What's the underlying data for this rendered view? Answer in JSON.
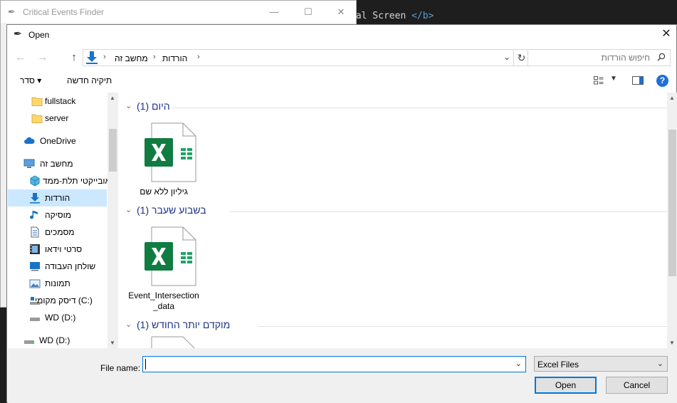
{
  "background": {
    "editor_code_prefix": "ial Screen ",
    "editor_code_tag": "</b>"
  },
  "parent_window": {
    "title": "Critical Events Finder",
    "minimize": "—",
    "maximize": "☐",
    "close": "✕"
  },
  "dialog": {
    "title": "Open",
    "close": "✕",
    "nav": {
      "back": "←",
      "forward": "→",
      "up": "↑"
    },
    "address": {
      "crumbs": [
        "מחשב זה",
        "הורדות"
      ],
      "separator": "›"
    },
    "search": {
      "placeholder": "חיפוש הורדות"
    },
    "toolbar": {
      "organize": "סדר ▾",
      "new_folder": "תיקיה חדשה",
      "view_drop": "▼",
      "help": "?"
    },
    "nav_pane": {
      "items": [
        {
          "label": "fullstack",
          "icon": "folder-icon"
        },
        {
          "label": "server",
          "icon": "folder-icon"
        },
        {
          "label": "OneDrive",
          "icon": "cloud-icon"
        },
        {
          "label": "מחשב זה",
          "icon": "computer-icon"
        },
        {
          "label": "אובייקטי תלת-ממד",
          "icon": "cube-icon"
        },
        {
          "label": "הורדות",
          "icon": "download-icon",
          "selected": true
        },
        {
          "label": "מוסיקה",
          "icon": "music-icon"
        },
        {
          "label": "מסמכים",
          "icon": "document-icon"
        },
        {
          "label": "סרטי וידאו",
          "icon": "video-icon"
        },
        {
          "label": "שולחן העבודה",
          "icon": "desktop-icon"
        },
        {
          "label": "תמונות",
          "icon": "pictures-icon"
        },
        {
          "label": "דיסק מקומי (C:)",
          "icon": "drive-icon"
        },
        {
          "label": "WD (D:)",
          "icon": "drive-icon"
        },
        {
          "label": "WD (D:)",
          "icon": "drive-icon"
        }
      ]
    },
    "groups": [
      {
        "label": "(1) היום",
        "files": [
          "גיליון ללא שם"
        ]
      },
      {
        "label": "(1) בשבוע שעבר",
        "files": [
          "Event_Intersection_data"
        ]
      },
      {
        "label": "(1) מוקדם יותר החודש",
        "files": []
      }
    ],
    "bottom": {
      "file_name_label": "File name:",
      "file_name_value": "",
      "file_type": "Excel Files",
      "open_label": "Open",
      "cancel_label": "Cancel"
    }
  },
  "colors": {
    "accent": "#0078d7",
    "group_header": "#1e3287",
    "selected_nav": "#cce8ff",
    "excel_green": "#107c41"
  }
}
